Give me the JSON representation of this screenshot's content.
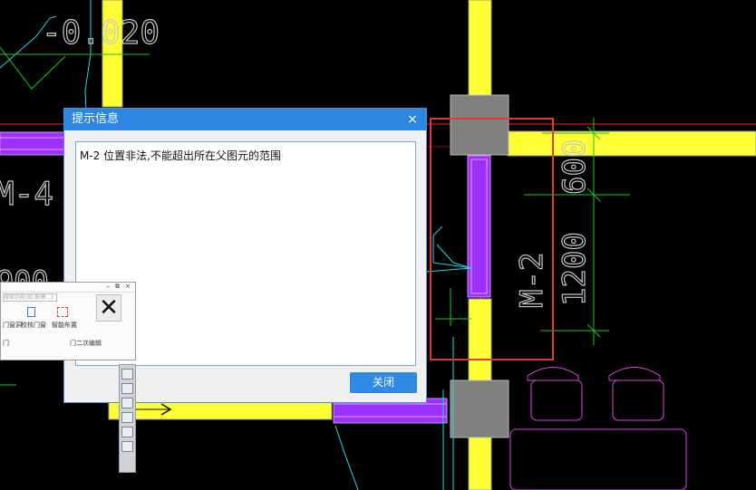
{
  "dialog": {
    "title": "提示信息",
    "close_glyph": "×",
    "message": "M-2 位置非法,不能超出所在父图元的范围",
    "button_label": "关闭"
  },
  "cad": {
    "elevation_label": "-0.020",
    "door_m4": "M-4",
    "partial_number": "900",
    "door_m2": "M-2",
    "dim_600": "600",
    "dim_1200": "1200"
  },
  "mini_panel": {
    "search_placeholder": "搜索功能(如:刚建…)",
    "group1_items": [
      "门窗洞",
      "校核门窗"
    ],
    "group1_label": "门",
    "group2_item": "智能布置",
    "group2_label": "门二次编辑",
    "close_glyph": "✕"
  },
  "colors": {
    "wall_yellow": "#ffff33",
    "door_purple": "#9b30ff",
    "dim_green": "#19c919",
    "leader_cyan": "#26d6e6",
    "axis_red": "#ff2020",
    "highlight_red": "#e53935",
    "furniture_magenta": "#e040e0",
    "column_gray": "#808080"
  }
}
